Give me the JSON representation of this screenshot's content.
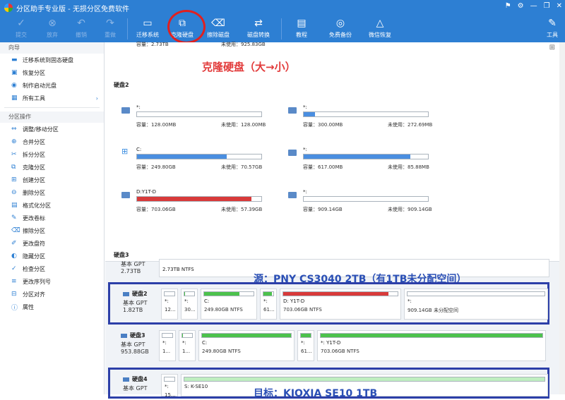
{
  "window": {
    "title": "分区助手专业版 - 无损分区免费软件",
    "btns": [
      "⚑",
      "⚙",
      "—",
      "❐",
      "✕"
    ]
  },
  "toolbar": {
    "commit": "提交",
    "discard": "放弃",
    "undo": "撤销",
    "redo": "重做",
    "migrate": "迁移系统",
    "clone": "克隆硬盘",
    "wipe": "擦除磁盘",
    "convert": "磁盘转换",
    "tutorial": "教程",
    "backup": "免费备份",
    "wechat": "微信恢复",
    "tools": "工具"
  },
  "sidebar": {
    "wizard_head": "向导",
    "wizard": [
      "迁移系统到固态硬盘",
      "恢复分区",
      "制作启动光盘",
      "所有工具"
    ],
    "ops_head": "分区操作",
    "ops": [
      "调整/移动分区",
      "合并分区",
      "拆分分区",
      "克隆分区",
      "创建分区",
      "删除分区",
      "格式化分区",
      "更改卷标",
      "擦除分区",
      "更改盘符",
      "隐藏分区",
      "检查分区",
      "更改序列号",
      "分区对齐",
      "属性"
    ]
  },
  "main": {
    "top_cap1": "容量：2.73TB",
    "top_cap2": "未使用：925.83GB",
    "annot_clone": "克隆硬盘（大→小）",
    "disk2_label": "硬盘2",
    "disk3_label": "硬盘3",
    "cards": [
      {
        "name": "*:",
        "cap": "容量：128.00MB",
        "unused": "未使用：128.00MB",
        "pct": 0,
        "color": "#4a8ee0"
      },
      {
        "name": "*:",
        "cap": "容量：300.00MB",
        "unused": "未使用：272.69MB",
        "pct": 9,
        "color": "#4a8ee0"
      },
      {
        "name": "C:",
        "cap": "容量：249.80GB",
        "unused": "未使用：70.57GB",
        "pct": 72,
        "color": "#4a8ee0"
      },
      {
        "name": "*:",
        "cap": "容量：617.00MB",
        "unused": "未使用：85.88MB",
        "pct": 86,
        "color": "#4a8ee0"
      },
      {
        "name": "D:Y1T-D",
        "cap": "容量：703.06GB",
        "unused": "未使用：57.39GB",
        "pct": 92,
        "color": "#d83a3a"
      },
      {
        "name": "*:",
        "cap": "容量：909.14GB",
        "unused": "未使用：909.14GB",
        "pct": 0,
        "color": "#4a8ee0"
      }
    ],
    "row0": {
      "size": "2.73TB",
      "part": "2.73TB NTFS",
      "type": "基本 GPT"
    },
    "annot_src": "源：PNY CS3040 2TB（有1TB未分配空间）",
    "rows": [
      {
        "name": "硬盘2",
        "type": "基本 GPT",
        "size": "1.82TB"
      },
      {
        "name": "硬盘3",
        "type": "基本 GPT",
        "size": "953.88GB"
      },
      {
        "name": "硬盘4",
        "type": "基本 GPT",
        "size": "..."
      }
    ],
    "r1parts": [
      {
        "n": "*:",
        "s": "12...",
        "pct": 0,
        "c": "#4cc24c"
      },
      {
        "n": "*:",
        "s": "30...",
        "pct": 10,
        "c": "#4cc24c"
      },
      {
        "n": "C:",
        "s": "249.80GB NTFS",
        "pct": 72,
        "c": "#4cc24c"
      },
      {
        "n": "*:",
        "s": "61...",
        "pct": 86,
        "c": "#4cc24c"
      },
      {
        "n": "D: Y1T-D",
        "s": "703.06GB NTFS",
        "pct": 92,
        "c": "#d83a3a"
      },
      {
        "n": "*:",
        "s": "909.14GB 未分配空间",
        "pct": 0,
        "c": "#4cc24c"
      }
    ],
    "r2parts": [
      {
        "n": "*:",
        "s": "1...",
        "pct": 0,
        "c": "#4cc24c"
      },
      {
        "n": "*:",
        "s": "1...",
        "pct": 10,
        "c": "#4cc24c"
      },
      {
        "n": "C:",
        "s": "249.80GB NTFS",
        "pct": 100,
        "c": "#4cc24c"
      },
      {
        "n": "*:",
        "s": "61...",
        "pct": 100,
        "c": "#4cc24c"
      },
      {
        "n": "*: Y1T-D",
        "s": "703.06GB NTFS",
        "pct": 100,
        "c": "#4cc24c"
      }
    ],
    "r3parts": [
      {
        "n": "*:",
        "s": "15...",
        "pct": 0,
        "c": "#4cc24c"
      },
      {
        "n": "S: K-SE10",
        "s": "",
        "pct": 100,
        "c": "#bfeec0"
      }
    ],
    "annot_dst": "目标：KIOXIA SE10 1TB"
  }
}
